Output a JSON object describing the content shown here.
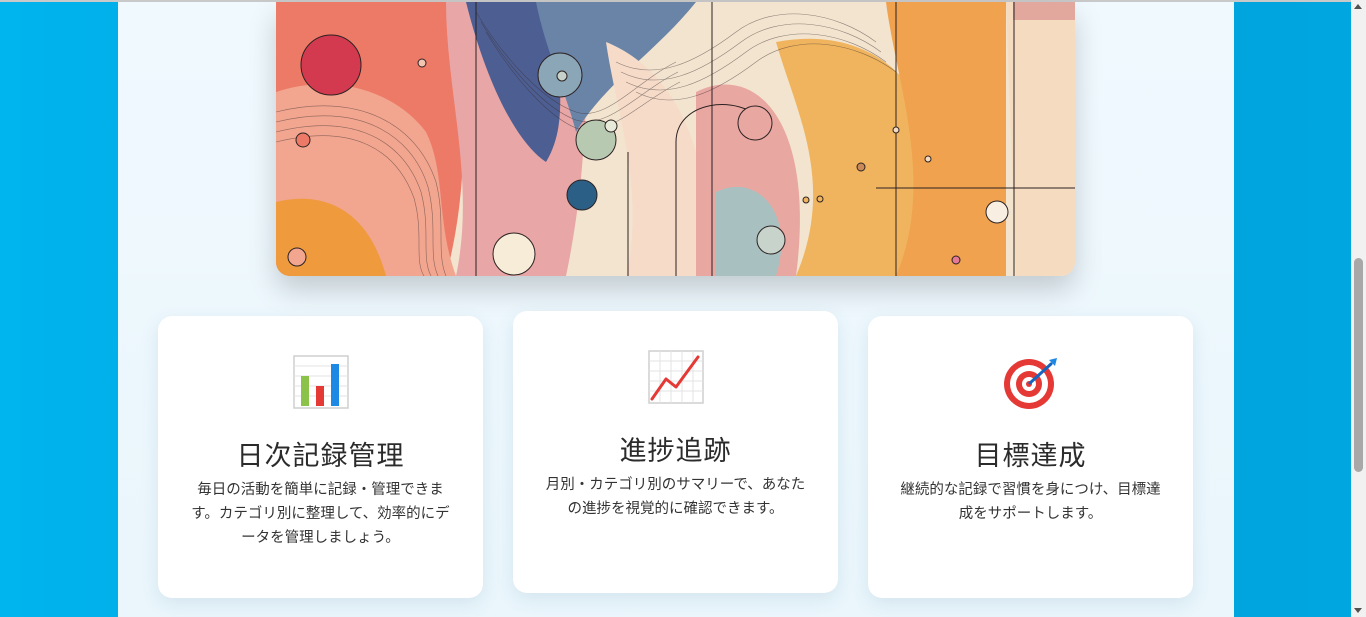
{
  "hero": {
    "image": "abstract-art-illustration"
  },
  "features": [
    {
      "icon": "bar-chart-icon",
      "title": "日次記録管理",
      "description": "毎日の活動を簡単に記録・管理できます。カテゴリ別に整理して、効率的にデータを管理しましょう。"
    },
    {
      "icon": "trend-chart-icon",
      "title": "進捗追跡",
      "description": "月別・カテゴリ別のサマリーで、あなたの進捗を視覚的に確認できます。"
    },
    {
      "icon": "target-icon",
      "title": "目標達成",
      "description": "継続的な記録で習慣を身につけ、目標達成をサポートします。"
    }
  ],
  "colors": {
    "background": "#00a6e0",
    "panel": "#eef8fd",
    "card": "#ffffff"
  }
}
